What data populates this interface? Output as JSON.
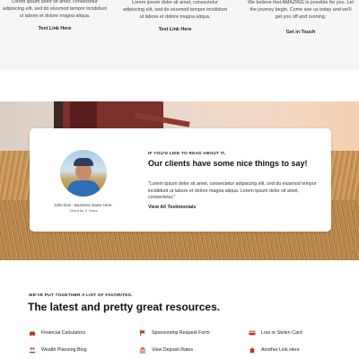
{
  "top_columns": [
    {
      "text": "Lorem ipsum dolor sit amet, consectetur adipiscing elit, sed do eiusmod tempor incididunt ut labore et dolore magna aliqua.",
      "link": "Text Link Here"
    },
    {
      "text": "Lorem ipsum dolor sit amet, consectetur adipiscing elit, sed do eiusmod tempor incididunt ut labore et dolore magna aliqua.",
      "link": "Text Link Here"
    },
    {
      "text": "We believe that AMAZING is possible for you. Let the journey begin. Come see us today and we'll get you off and running.",
      "link": "Get in Touch"
    }
  ],
  "testimonial": {
    "eyebrow": "IF YOU'D LIKE TO READ ABOUT IT,",
    "headline": "Our clients have some nice things to say!",
    "quote": "\"Lorem ipsum dolor sit amet, consectetur adipiscing elit, sed do eiusmod tempor incididunt ut labore et dolore magna aliqua. Lorem ipsum dolor sit amet, consectetur.\"",
    "view_link": "View All Testimonials",
    "person_name": "John Doe - Business Name Here.",
    "person_sub": "Client for X Years"
  },
  "resources": {
    "eyebrow": "WE'VE PUT TOGETHER A LIST OF FAVORITES.",
    "title": "The latest and pretty great resources.",
    "items": [
      {
        "label": "Financial Calculators",
        "icon": "car-icon"
      },
      {
        "label": "Sponsorship Request Form",
        "icon": "flag-icon"
      },
      {
        "label": "Lost or Stolen Card",
        "icon": "card-icon"
      },
      {
        "label": "Wealth Planning Blog",
        "icon": "people-icon"
      },
      {
        "label": "View Deposit Rates",
        "icon": "building-icon"
      },
      {
        "label": "Another Link Here",
        "icon": "house-icon"
      }
    ]
  },
  "colors": {
    "accent": "#c0392b",
    "top_band_bg": "#f6f6f6",
    "text": "#222222"
  }
}
